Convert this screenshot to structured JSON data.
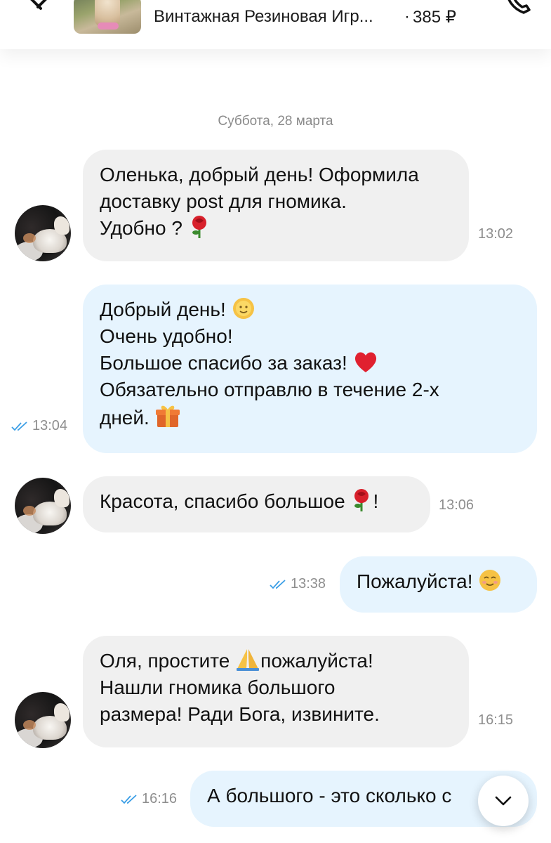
{
  "header": {
    "product_title": "Винтажная Резиновая Игр...",
    "separator": "·",
    "price": "385 ₽"
  },
  "date_separator": "Суббота, 28 марта",
  "messages": [
    {
      "direction": "incoming",
      "lines": [
        "Оленька, добрый день! Оформила",
        "доставку post  для гномика.",
        "Удобно ?"
      ],
      "emoji": [
        "rose-emoji"
      ],
      "time": "13:02"
    },
    {
      "direction": "outgoing",
      "lines": [
        "Добрый день!",
        "Очень удобно!",
        "Большое спасибо за заказ!",
        "Обязательно отправлю в течение 2-х",
        "дней."
      ],
      "emoji": [
        "sun-emoji",
        "heart-emoji",
        "gift-emoji"
      ],
      "time": "13:04",
      "status": "read"
    },
    {
      "direction": "incoming",
      "lines": [
        "Красота, спасибо большое",
        "!"
      ],
      "emoji": [
        "rose-emoji"
      ],
      "time": "13:06"
    },
    {
      "direction": "outgoing",
      "lines": [
        "Пожалуйста!"
      ],
      "emoji": [
        "smile-emoji"
      ],
      "time": "13:38",
      "status": "read"
    },
    {
      "direction": "incoming",
      "lines": [
        "Оля, простите",
        "пожалуйста!",
        "Нашли гномика большого",
        "размера! Ради Бога, извините."
      ],
      "emoji": [
        "pray-emoji"
      ],
      "time": "16:15"
    },
    {
      "direction": "outgoing",
      "lines": [
        "А большого - это сколько с"
      ],
      "time": "16:16",
      "status": "read"
    }
  ],
  "colors": {
    "incoming_bubble": "#f0f0f0",
    "outgoing_bubble": "#e6f4fe",
    "read_ticks": "#3a9ee6",
    "timestamp": "#8e8e8e"
  },
  "icons": [
    "back-arrow-icon",
    "phone-icon",
    "double-check-icon",
    "chevron-down-icon"
  ]
}
